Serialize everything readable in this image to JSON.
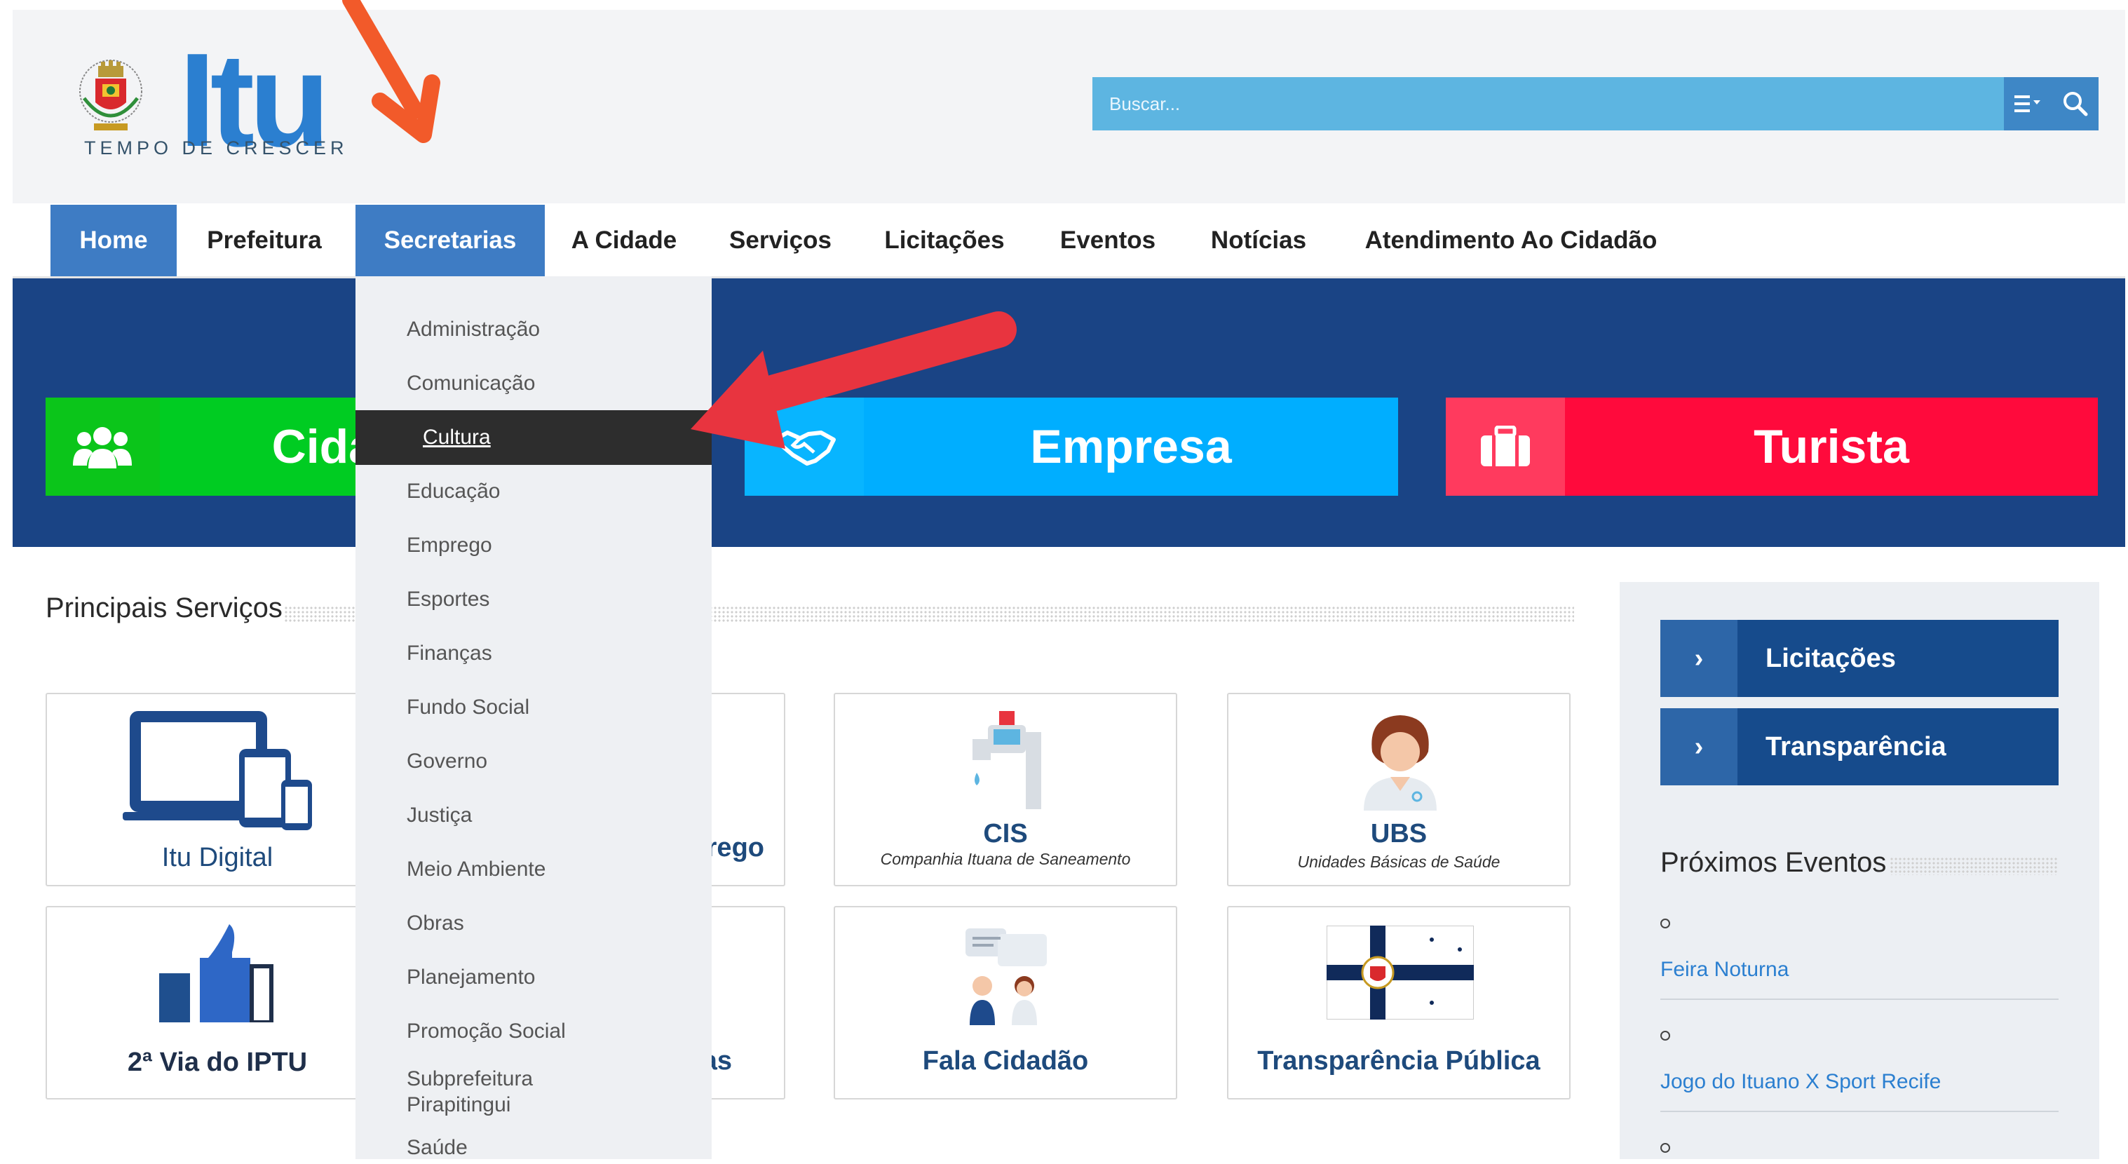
{
  "colors": {
    "nav_active": "#3e7cc4",
    "hero_bg": "#1a4485",
    "cidadao_green": "#0bcf1e",
    "empresa_blue": "#00aeff",
    "turista_red": "#ff0a3c",
    "sidebar_button": "#164b8c",
    "link_blue": "#2b7fd0",
    "annotation_red": "#e8343f",
    "annotation_orange": "#f25a2a"
  },
  "header": {
    "logo_text": "Itu",
    "logo_tagline": "TEMPO DE CRESCER",
    "seal_icon": "city-coat-of-arms",
    "search_placeholder": "Buscar...",
    "search_options_icon": "filter-list-icon",
    "search_icon": "magnifier-icon"
  },
  "nav": {
    "items": [
      {
        "label": "Home"
      },
      {
        "label": "Prefeitura"
      },
      {
        "label": "Secretarias"
      },
      {
        "label": "A Cidade"
      },
      {
        "label": "Serviços"
      },
      {
        "label": "Licitações"
      },
      {
        "label": "Eventos"
      },
      {
        "label": "Notícias"
      },
      {
        "label": "Atendimento Ao Cidadão"
      }
    ]
  },
  "hero": {
    "cards": [
      {
        "label": "Cida",
        "icon": "people-group-icon"
      },
      {
        "label": "Empresa",
        "icon": "handshake-icon"
      },
      {
        "label": "Turista",
        "icon": "briefcase-icon"
      }
    ]
  },
  "services": {
    "title": "Principais Serviços",
    "tiles": [
      {
        "title": "Itu Digital",
        "subtitle": "",
        "icon": "devices-icon"
      },
      {
        "title": "rego",
        "subtitle": "",
        "icon": ""
      },
      {
        "title": "CIS",
        "subtitle": "Companhia Ituana de Saneamento",
        "icon": "water-tap-icon"
      },
      {
        "title": "UBS",
        "subtitle": "Unidades Básicas de Saúde",
        "icon": "doctor-icon"
      },
      {
        "title": "2ª Via do IPTU",
        "subtitle": "",
        "icon": "thumbs-up-icon"
      },
      {
        "title": "as",
        "subtitle": "",
        "icon": ""
      },
      {
        "title": "Fala Cidadão",
        "subtitle": "",
        "icon": "chat-people-icon"
      },
      {
        "title": "Transparência Pública",
        "subtitle": "",
        "icon": "city-flag-icon"
      }
    ]
  },
  "sidebar": {
    "buttons": [
      {
        "label": "Licitações"
      },
      {
        "label": "Transparência"
      }
    ],
    "events_title": "Próximos Eventos",
    "events": [
      {
        "label": "Feira Noturna"
      },
      {
        "label": "Jogo do Ituano X Sport Recife"
      }
    ]
  },
  "dropdown": {
    "items": [
      {
        "label": "Administração"
      },
      {
        "label": "Comunicação"
      },
      {
        "label": "Cultura"
      },
      {
        "label": "Educação"
      },
      {
        "label": "Emprego"
      },
      {
        "label": "Esportes"
      },
      {
        "label": "Finanças"
      },
      {
        "label": "Fundo Social"
      },
      {
        "label": "Governo"
      },
      {
        "label": "Justiça"
      },
      {
        "label": "Meio Ambiente"
      },
      {
        "label": "Obras"
      },
      {
        "label": "Planejamento"
      },
      {
        "label": "Promoção Social"
      },
      {
        "label": "Subprefeitura Pirapitingui"
      },
      {
        "label": "Saúde"
      }
    ],
    "selected": "Cultura"
  }
}
